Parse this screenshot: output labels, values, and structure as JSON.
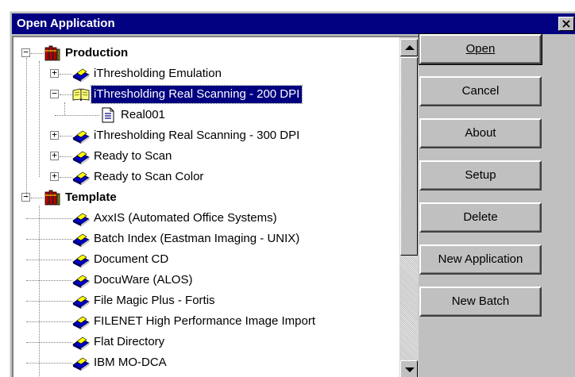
{
  "window": {
    "title": "Open Application",
    "close_label": "×"
  },
  "tree": {
    "groups": [
      {
        "label": "Production",
        "expander": "−",
        "items": [
          {
            "label": "iThresholding Emulation",
            "expander": "+"
          },
          {
            "label": "iThresholding Real Scanning - 200 DPI",
            "expander": "−",
            "selected": true,
            "children": [
              {
                "label": "Real001"
              }
            ]
          },
          {
            "label": "iThresholding Real Scanning - 300 DPI",
            "expander": "+"
          },
          {
            "label": "Ready to Scan",
            "expander": "+"
          },
          {
            "label": "Ready to Scan Color",
            "expander": "+"
          }
        ]
      },
      {
        "label": "Template",
        "expander": "−",
        "items": [
          {
            "label": "AxxIS (Automated Office Systems)"
          },
          {
            "label": "Batch Index (Eastman Imaging - UNIX)"
          },
          {
            "label": "Document CD"
          },
          {
            "label": "DocuWare (ALOS)"
          },
          {
            "label": "File Magic Plus - Fortis"
          },
          {
            "label": "FILENET High Performance Image Import"
          },
          {
            "label": "Flat Directory"
          },
          {
            "label": "IBM MO-DCA"
          }
        ]
      }
    ]
  },
  "buttons": {
    "open": "Open",
    "cancel": "Cancel",
    "about": "About",
    "setup": "Setup",
    "delete": "Delete",
    "new_application": "New Application",
    "new_batch": "New Batch"
  },
  "colors": {
    "selection": "#000080",
    "titlebar": "#000080",
    "face": "#c0c0c0"
  }
}
